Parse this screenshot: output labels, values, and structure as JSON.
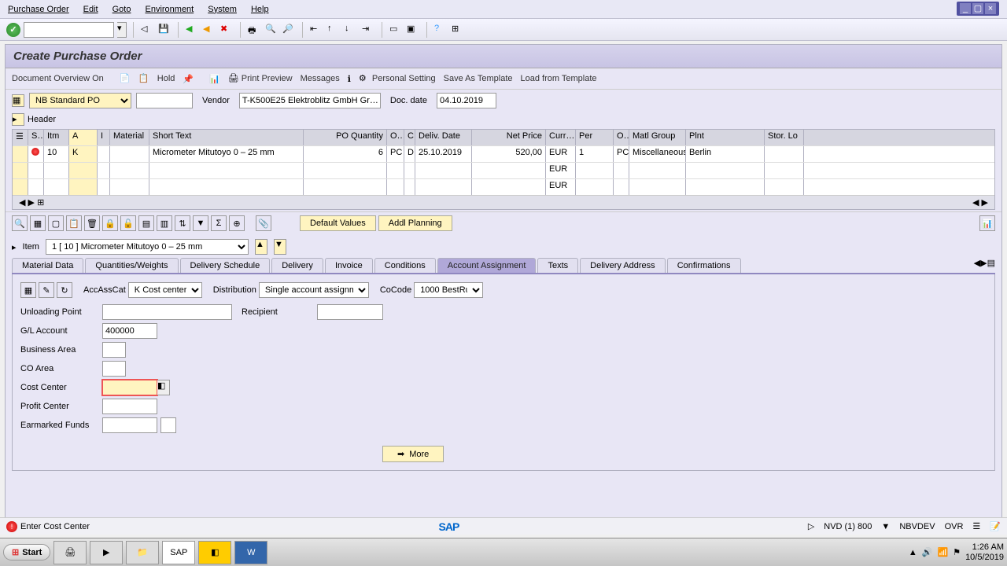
{
  "menu": {
    "po": "Purchase Order",
    "edit": "Edit",
    "goto": "Goto",
    "env": "Environment",
    "system": "System",
    "help": "Help"
  },
  "page": {
    "title": "Create Purchase Order"
  },
  "app_toolbar": {
    "doc_overview": "Document Overview On",
    "hold": "Hold",
    "print_preview": "Print Preview",
    "messages": "Messages",
    "personal_setting": "Personal Setting",
    "save_template": "Save As Template",
    "load_template": "Load from Template"
  },
  "doc": {
    "type": "NB Standard PO",
    "po_number": "",
    "vendor_label": "Vendor",
    "vendor": "T-K500E25 Elektroblitz GmbH Gr…",
    "docdate_label": "Doc. date",
    "docdate": "04.10.2019",
    "header_label": "Header"
  },
  "grid": {
    "cols": {
      "s": "S…",
      "itm": "Itm",
      "a": "A",
      "i": "I",
      "material": "Material",
      "short_text": "Short Text",
      "po_qty": "PO Quantity",
      "oun": "O…",
      "c": "C",
      "deliv_date": "Deliv. Date",
      "net_price": "Net Price",
      "curr": "Curr…",
      "per": "Per",
      "opu": "O…",
      "matl_group": "Matl Group",
      "plnt": "Plnt",
      "sloc": "Stor. Lo"
    },
    "rows": [
      {
        "itm": "10",
        "a": "K",
        "i": "",
        "material": "",
        "short_text": "Micrometer Mitutoyo 0 – 25 mm",
        "qty": "6",
        "un": "PC",
        "c": "D",
        "deliv_date": "25.10.2019",
        "net_price": "520,00",
        "curr": "EUR",
        "per": "1",
        "opu": "PC",
        "matl_group": "Miscellaneous",
        "plnt": "Berlin"
      },
      {
        "curr": "EUR"
      },
      {
        "curr": "EUR"
      }
    ]
  },
  "grid_buttons": {
    "default_values": "Default Values",
    "addl_planning": "Addl Planning"
  },
  "item_detail": {
    "label": "Item",
    "selector": "1 [ 10 ] Micrometer Mitutoyo 0 – 25 mm",
    "tabs": {
      "material": "Material Data",
      "qty": "Quantities/Weights",
      "sched": "Delivery Schedule",
      "delivery": "Delivery",
      "invoice": "Invoice",
      "conditions": "Conditions",
      "account": "Account Assignment",
      "texts": "Texts",
      "addr": "Delivery Address",
      "confirm": "Confirmations"
    }
  },
  "account": {
    "accasscat_label": "AccAssCat",
    "accasscat": "K Cost center",
    "distribution_label": "Distribution",
    "distribution": "Single account assignm…",
    "cocode_label": "CoCode",
    "cocode": "1000 BestRu…",
    "unloading_point_label": "Unloading Point",
    "unloading_point": "",
    "recipient_label": "Recipient",
    "recipient": "",
    "gl_account_label": "G/L Account",
    "gl_account": "400000",
    "business_area_label": "Business Area",
    "business_area": "",
    "co_area_label": "CO Area",
    "co_area": "",
    "cost_center_label": "Cost Center",
    "cost_center": "",
    "profit_center_label": "Profit Center",
    "profit_center": "",
    "earmarked_label": "Earmarked Funds",
    "earmarked": "",
    "more": "More"
  },
  "status": {
    "message": "Enter Cost Center",
    "session": "NVD (1) 800",
    "server": "NBVDEV",
    "mode": "OVR"
  },
  "taskbar": {
    "start": "Start",
    "time": "1:26 AM",
    "date": "10/5/2019"
  }
}
